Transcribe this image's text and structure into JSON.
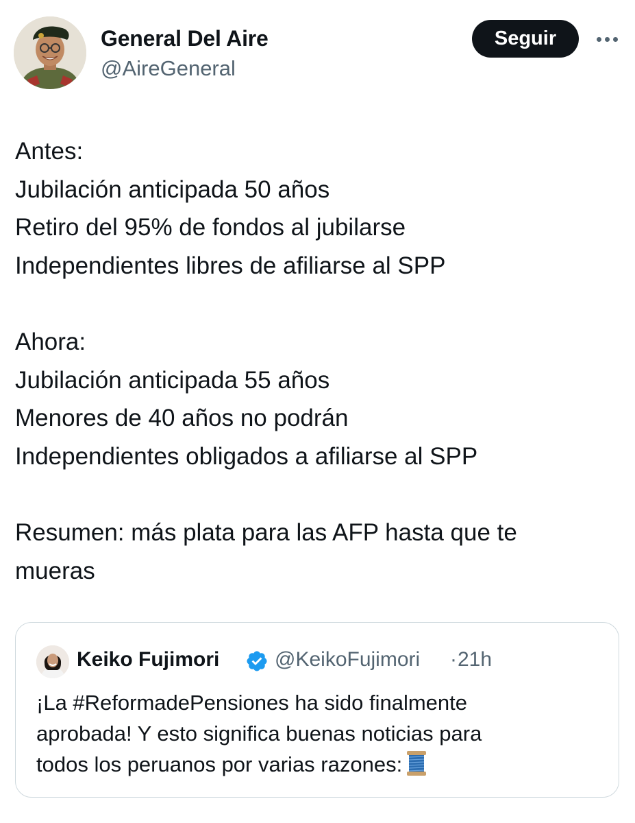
{
  "tweet": {
    "author": {
      "name": "General Del Aire",
      "handle": "@AireGeneral",
      "avatar_icon": "profile-photo-military-man"
    },
    "follow_label": "Seguir",
    "more_icon": "more-horizontal-icon",
    "text": {
      "antes_heading": "Antes:",
      "antes_lines": [
        "Jubilación anticipada 50 años",
        "Retiro del 95% de fondos al jubilarse",
        "Independientes libres de afiliarse al SPP"
      ],
      "ahora_heading": "Ahora:",
      "ahora_lines": [
        "Jubilación anticipada 55 años",
        "Menores de 40 años no podrán",
        "Independientes obligados a afiliarse al SPP"
      ],
      "summary": "Resumen: más plata para las AFP hasta que te mueras"
    },
    "quoted": {
      "name": "Keiko Fujimori",
      "verified": true,
      "handle": "@KeikoFujimori",
      "separator": "·",
      "time": "21h",
      "text_lines": [
        "¡La #ReformadePensiones ha sido finalmente",
        "aprobada! Y esto significa buenas noticias para",
        "todos los peruanos por varias razones:"
      ],
      "emoji_icon": "thread-spool-icon"
    },
    "colors": {
      "text": "#0f1419",
      "secondary": "#536471",
      "verified": "#1d9bf0",
      "border": "#cfd9de",
      "button_bg": "#0f1419"
    }
  }
}
